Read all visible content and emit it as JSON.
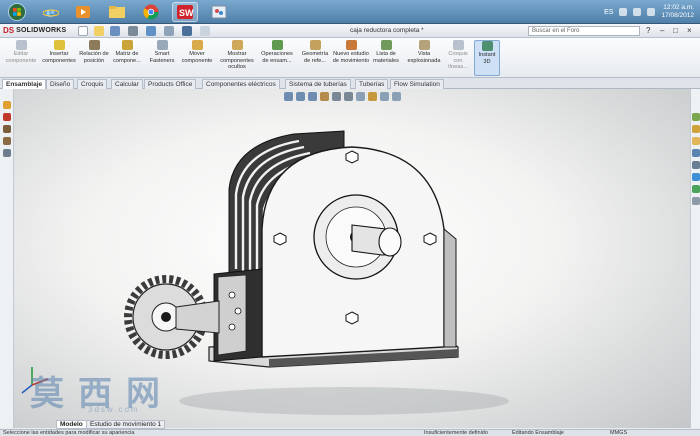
{
  "taskbar": {
    "apps": [
      {
        "name": "start-button"
      },
      {
        "name": "internet-explorer-icon"
      },
      {
        "name": "media-player-icon"
      },
      {
        "name": "file-explorer-icon"
      },
      {
        "name": "chrome-icon"
      },
      {
        "name": "solidworks-icon"
      },
      {
        "name": "paint-icon"
      }
    ],
    "language": "ES",
    "time": "12:02 a.m.",
    "date": "17/08/2012"
  },
  "titlebar": {
    "brand_ds": "DS",
    "brand_name": "SOLIDWORKS",
    "document_title": "caja reductora completa *",
    "search_placeholder": "Buscar en el Foro"
  },
  "commands": [
    {
      "label": "Editar componente",
      "disabled": true
    },
    {
      "label": "Insertar componentes"
    },
    {
      "label": "Relación de posición"
    },
    {
      "label": "Matriz de compone..."
    },
    {
      "label": "Smart Fasteners"
    },
    {
      "label": "Mover componente"
    },
    {
      "label": "Mostrar componentes ocultos"
    },
    {
      "label": "Operaciones de ensam..."
    },
    {
      "label": "Geometría de refe..."
    },
    {
      "label": "Nuevo estudio de movimiento"
    },
    {
      "label": "Lista de materiales"
    },
    {
      "label": "Vista explosionada"
    },
    {
      "label": "Croquis con líneas...",
      "disabled": true
    },
    {
      "label": "Instant 3D",
      "active": true
    }
  ],
  "tabs": [
    "Ensamblaje",
    "Diseño",
    "Croquis",
    "Calcular",
    "Products Office",
    "Componentes eléctricos",
    "Sistema de tuberías",
    "Tuberías",
    "Flow Simulation"
  ],
  "active_tab": "Ensamblaje",
  "watermark": {
    "main": "莫西网",
    "sub": "3dsw.com"
  },
  "model_tabs": [
    "Modelo",
    "Estudio de movimiento 1"
  ],
  "active_model_tab": "Modelo",
  "status": {
    "left": "Seleccione las entidades para modificar su apariencia",
    "definition": "Insuficientemente definido",
    "mode": "Editando Ensamblaje",
    "units": "MMGS"
  },
  "colors": {
    "accent": "#c21f28",
    "active_tab": "#ffffff",
    "instant3d": "#cde0f5"
  }
}
